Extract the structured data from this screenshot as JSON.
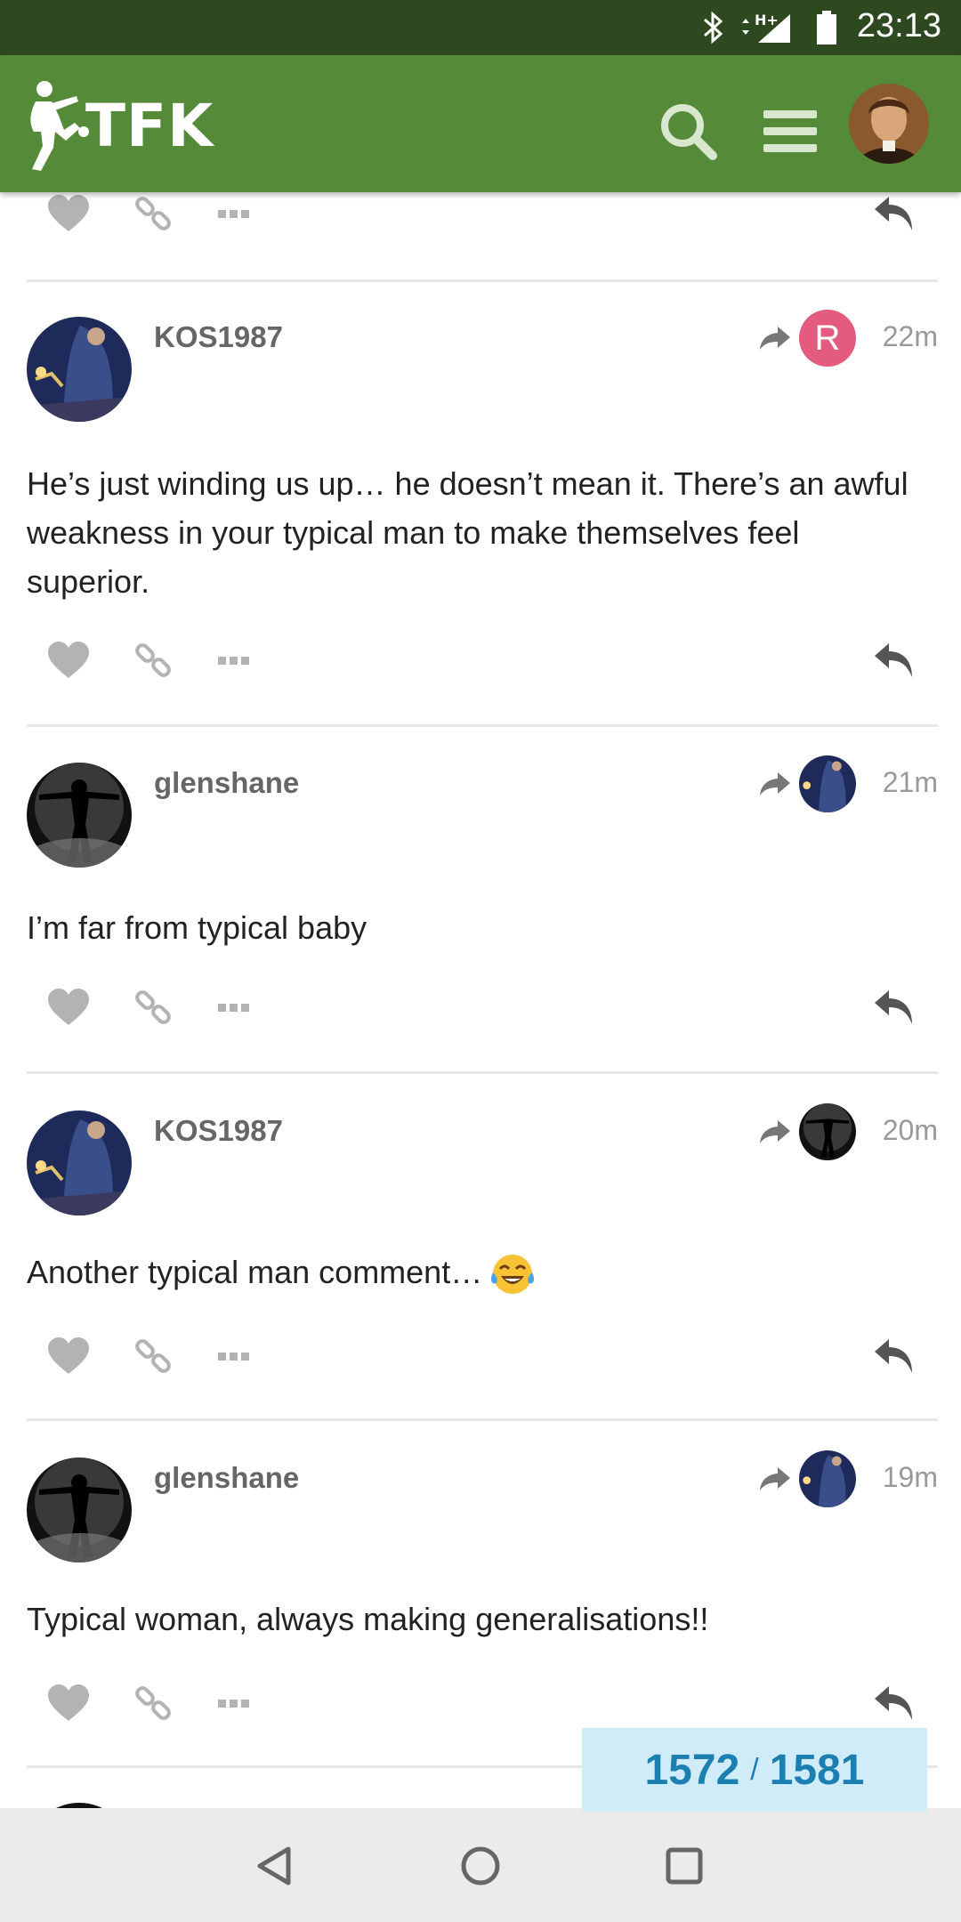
{
  "status_bar": {
    "time": "23:13",
    "icons": [
      "bluetooth-icon",
      "data-arrows-icon",
      "signal-icon",
      "battery-icon"
    ],
    "network_label": "H+"
  },
  "header": {
    "logo_text": "TFK",
    "icons": [
      "search-icon",
      "hamburger-menu-icon"
    ]
  },
  "posts": [
    {
      "username": "KOS1987",
      "avatar": "kos-avatar",
      "reply_to_avatar_letter": "R",
      "age": "22m",
      "body": "He’s just winding us up… he doesn’t mean it. There’s an awful weakness in your typical man to make themselves feel superior."
    },
    {
      "username": "glenshane",
      "avatar": "glenshane-avatar",
      "reply_to_avatar": "kos-avatar",
      "age": "21m",
      "body": "I’m far from typical baby"
    },
    {
      "username": "KOS1987",
      "avatar": "kos-avatar",
      "reply_to_avatar": "glenshane-avatar",
      "age": "20m",
      "body": "Another typical man comment…",
      "emoji": "tears-of-joy-emoji"
    },
    {
      "username": "glenshane",
      "avatar": "glenshane-avatar",
      "reply_to_avatar": "kos-avatar",
      "age": "19m",
      "body": "Typical woman, always making generalisations!!"
    }
  ],
  "progress": {
    "current": "1572",
    "separator": "/",
    "total": "1581"
  },
  "colors": {
    "header_green": "#558b38",
    "status_bar": "#2e4820",
    "progress_bg": "#d1ecf9",
    "progress_text": "#1c7fb2",
    "reply_letter_avatar": "#e35c80"
  }
}
